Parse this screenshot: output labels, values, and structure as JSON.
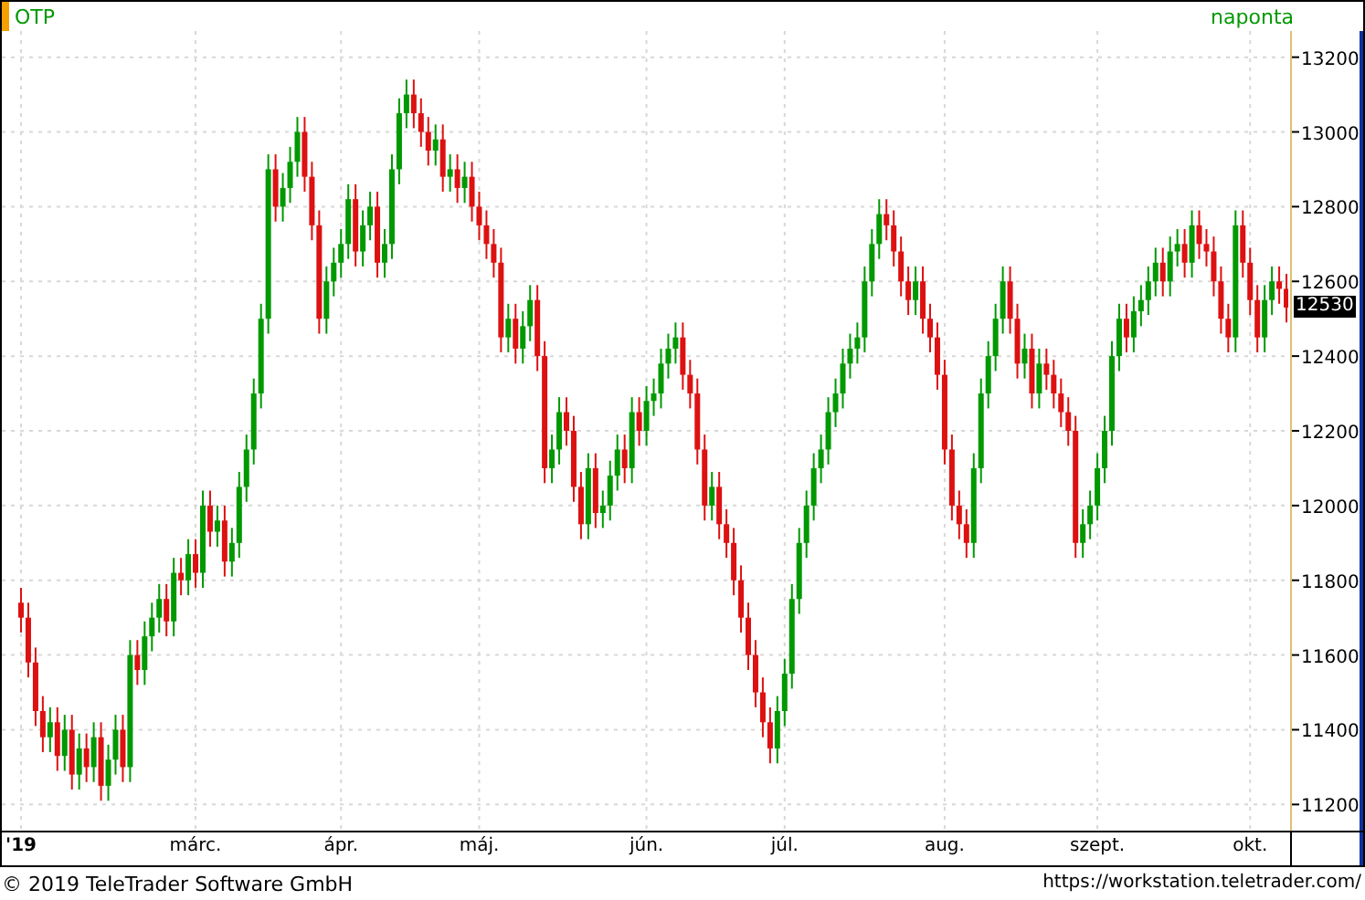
{
  "header": {
    "symbol": "OTP",
    "interval": "naponta"
  },
  "chart": {
    "price_marker": "12530",
    "chart_data": {
      "type": "candlestick",
      "grid": true,
      "ylim": [
        11130,
        13270
      ],
      "categories": [
        "'19",
        null,
        null,
        null,
        null,
        null,
        null,
        null,
        null,
        null,
        null,
        null,
        null,
        null,
        null,
        null,
        null,
        null,
        null,
        null,
        null,
        null,
        null,
        null,
        "márc.",
        null,
        null,
        null,
        null,
        null,
        null,
        null,
        null,
        null,
        null,
        null,
        null,
        null,
        null,
        null,
        null,
        null,
        null,
        null,
        "ápr.",
        null,
        null,
        null,
        null,
        null,
        null,
        null,
        null,
        null,
        null,
        null,
        null,
        null,
        null,
        null,
        null,
        null,
        null,
        "máj.",
        null,
        null,
        null,
        null,
        null,
        null,
        null,
        null,
        null,
        null,
        null,
        null,
        null,
        null,
        null,
        null,
        null,
        null,
        null,
        null,
        null,
        null,
        "jún.",
        null,
        null,
        null,
        null,
        null,
        null,
        null,
        null,
        null,
        null,
        null,
        null,
        null,
        null,
        null,
        null,
        null,
        null,
        "júl.",
        null,
        null,
        null,
        null,
        null,
        null,
        null,
        null,
        null,
        null,
        null,
        null,
        null,
        null,
        null,
        null,
        null,
        null,
        null,
        null,
        null,
        "aug.",
        null,
        null,
        null,
        null,
        null,
        null,
        null,
        null,
        null,
        null,
        null,
        null,
        null,
        null,
        null,
        null,
        null,
        null,
        null,
        null,
        "szept.",
        null,
        null,
        null,
        null,
        null,
        null,
        null,
        null,
        null,
        null,
        null,
        null,
        null,
        null,
        null,
        null,
        null,
        null,
        null,
        null,
        "okt.",
        null,
        null,
        null,
        null,
        null
      ],
      "yticks": [
        {
          "value": 11200,
          "label": "11200"
        },
        {
          "value": 11400,
          "label": "11400"
        },
        {
          "value": 11600,
          "label": "11600"
        },
        {
          "value": 11800,
          "label": "11800"
        },
        {
          "value": 12000,
          "label": "12000"
        },
        {
          "value": 12200,
          "label": "12200"
        },
        {
          "value": 12400,
          "label": "12400"
        },
        {
          "value": 12600,
          "label": "12600"
        },
        {
          "value": 12800,
          "label": "12800"
        },
        {
          "value": 13000,
          "label": "13000"
        },
        {
          "value": 13200,
          "label": "13200"
        }
      ],
      "ohlc": [
        [
          11740,
          11780,
          11660,
          11700
        ],
        [
          11700,
          11740,
          11540,
          11580
        ],
        [
          11580,
          11620,
          11410,
          11450
        ],
        [
          11450,
          11490,
          11340,
          11380
        ],
        [
          11380,
          11460,
          11340,
          11420
        ],
        [
          11420,
          11460,
          11290,
          11330
        ],
        [
          11330,
          11440,
          11290,
          11400
        ],
        [
          11400,
          11440,
          11240,
          11280
        ],
        [
          11280,
          11390,
          11240,
          11350
        ],
        [
          11350,
          11390,
          11260,
          11300
        ],
        [
          11300,
          11420,
          11260,
          11380
        ],
        [
          11380,
          11420,
          11210,
          11250
        ],
        [
          11250,
          11360,
          11210,
          11320
        ],
        [
          11320,
          11440,
          11280,
          11400
        ],
        [
          11400,
          11440,
          11260,
          11300
        ],
        [
          11300,
          11640,
          11260,
          11600
        ],
        [
          11600,
          11640,
          11520,
          11560
        ],
        [
          11560,
          11690,
          11520,
          11650
        ],
        [
          11650,
          11740,
          11610,
          11700
        ],
        [
          11700,
          11790,
          11660,
          11750
        ],
        [
          11750,
          11790,
          11650,
          11690
        ],
        [
          11690,
          11860,
          11650,
          11820
        ],
        [
          11820,
          11860,
          11760,
          11800
        ],
        [
          11800,
          11910,
          11760,
          11870
        ],
        [
          11870,
          11910,
          11780,
          11820
        ],
        [
          11820,
          12040,
          11780,
          12000
        ],
        [
          12000,
          12040,
          11890,
          11930
        ],
        [
          11930,
          12000,
          11890,
          11960
        ],
        [
          11960,
          12000,
          11810,
          11850
        ],
        [
          11850,
          11940,
          11810,
          11900
        ],
        [
          11900,
          12090,
          11860,
          12050
        ],
        [
          12050,
          12190,
          12010,
          12150
        ],
        [
          12150,
          12340,
          12110,
          12300
        ],
        [
          12300,
          12540,
          12260,
          12500
        ],
        [
          12500,
          12940,
          12460,
          12900
        ],
        [
          12900,
          12940,
          12760,
          12800
        ],
        [
          12800,
          12890,
          12760,
          12850
        ],
        [
          12850,
          12960,
          12810,
          12920
        ],
        [
          12920,
          13040,
          12880,
          13000
        ],
        [
          13000,
          13040,
          12840,
          12880
        ],
        [
          12880,
          12920,
          12710,
          12750
        ],
        [
          12750,
          12790,
          12460,
          12500
        ],
        [
          12500,
          12640,
          12460,
          12600
        ],
        [
          12600,
          12690,
          12560,
          12650
        ],
        [
          12650,
          12740,
          12610,
          12700
        ],
        [
          12700,
          12860,
          12660,
          12820
        ],
        [
          12820,
          12860,
          12640,
          12680
        ],
        [
          12680,
          12790,
          12640,
          12750
        ],
        [
          12750,
          12840,
          12710,
          12800
        ],
        [
          12800,
          12840,
          12610,
          12650
        ],
        [
          12650,
          12740,
          12610,
          12700
        ],
        [
          12700,
          12940,
          12660,
          12900
        ],
        [
          12900,
          13090,
          12860,
          13050
        ],
        [
          13050,
          13140,
          13010,
          13100
        ],
        [
          13100,
          13140,
          13010,
          13050
        ],
        [
          13050,
          13090,
          12960,
          13000
        ],
        [
          13000,
          13040,
          12910,
          12950
        ],
        [
          12950,
          13020,
          12910,
          12980
        ],
        [
          12980,
          13020,
          12840,
          12880
        ],
        [
          12880,
          12940,
          12840,
          12900
        ],
        [
          12900,
          12940,
          12810,
          12850
        ],
        [
          12850,
          12920,
          12810,
          12880
        ],
        [
          12880,
          12920,
          12760,
          12800
        ],
        [
          12800,
          12840,
          12710,
          12750
        ],
        [
          12750,
          12790,
          12660,
          12700
        ],
        [
          12700,
          12740,
          12610,
          12650
        ],
        [
          12650,
          12690,
          12410,
          12450
        ],
        [
          12450,
          12540,
          12410,
          12500
        ],
        [
          12500,
          12540,
          12380,
          12420
        ],
        [
          12420,
          12520,
          12380,
          12480
        ],
        [
          12480,
          12590,
          12440,
          12550
        ],
        [
          12550,
          12590,
          12360,
          12400
        ],
        [
          12400,
          12440,
          12060,
          12100
        ],
        [
          12100,
          12190,
          12060,
          12150
        ],
        [
          12150,
          12290,
          12110,
          12250
        ],
        [
          12250,
          12290,
          12160,
          12200
        ],
        [
          12200,
          12240,
          12010,
          12050
        ],
        [
          12050,
          12090,
          11910,
          11950
        ],
        [
          11950,
          12140,
          11910,
          12100
        ],
        [
          12100,
          12140,
          11940,
          11980
        ],
        [
          11980,
          12040,
          11940,
          12000
        ],
        [
          12000,
          12120,
          11960,
          12080
        ],
        [
          12080,
          12190,
          12040,
          12150
        ],
        [
          12150,
          12190,
          12060,
          12100
        ],
        [
          12100,
          12290,
          12060,
          12250
        ],
        [
          12250,
          12290,
          12160,
          12200
        ],
        [
          12200,
          12320,
          12160,
          12280
        ],
        [
          12280,
          12340,
          12240,
          12300
        ],
        [
          12300,
          12420,
          12260,
          12380
        ],
        [
          12380,
          12460,
          12340,
          12420
        ],
        [
          12420,
          12490,
          12380,
          12450
        ],
        [
          12450,
          12490,
          12310,
          12350
        ],
        [
          12350,
          12390,
          12260,
          12300
        ],
        [
          12300,
          12340,
          12110,
          12150
        ],
        [
          12150,
          12190,
          11960,
          12000
        ],
        [
          12000,
          12090,
          11960,
          12050
        ],
        [
          12050,
          12090,
          11910,
          11950
        ],
        [
          11950,
          11990,
          11860,
          11900
        ],
        [
          11900,
          11940,
          11760,
          11800
        ],
        [
          11800,
          11840,
          11660,
          11700
        ],
        [
          11700,
          11740,
          11560,
          11600
        ],
        [
          11600,
          11640,
          11460,
          11500
        ],
        [
          11500,
          11540,
          11380,
          11420
        ],
        [
          11420,
          11460,
          11310,
          11350
        ],
        [
          11350,
          11490,
          11310,
          11450
        ],
        [
          11450,
          11590,
          11410,
          11550
        ],
        [
          11550,
          11790,
          11510,
          11750
        ],
        [
          11750,
          11940,
          11710,
          11900
        ],
        [
          11900,
          12040,
          11860,
          12000
        ],
        [
          12000,
          12140,
          11960,
          12100
        ],
        [
          12100,
          12190,
          12060,
          12150
        ],
        [
          12150,
          12290,
          12110,
          12250
        ],
        [
          12250,
          12340,
          12210,
          12300
        ],
        [
          12300,
          12420,
          12260,
          12380
        ],
        [
          12380,
          12460,
          12340,
          12420
        ],
        [
          12420,
          12490,
          12380,
          12450
        ],
        [
          12450,
          12640,
          12410,
          12600
        ],
        [
          12600,
          12740,
          12560,
          12700
        ],
        [
          12700,
          12820,
          12660,
          12780
        ],
        [
          12780,
          12820,
          12710,
          12750
        ],
        [
          12750,
          12790,
          12640,
          12680
        ],
        [
          12680,
          12720,
          12560,
          12600
        ],
        [
          12600,
          12640,
          12510,
          12550
        ],
        [
          12550,
          12640,
          12510,
          12600
        ],
        [
          12600,
          12640,
          12460,
          12500
        ],
        [
          12500,
          12540,
          12410,
          12450
        ],
        [
          12450,
          12490,
          12310,
          12350
        ],
        [
          12350,
          12390,
          12110,
          12150
        ],
        [
          12150,
          12190,
          11960,
          12000
        ],
        [
          12000,
          12040,
          11910,
          11950
        ],
        [
          11950,
          11990,
          11860,
          11900
        ],
        [
          11900,
          12140,
          11860,
          12100
        ],
        [
          12100,
          12340,
          12060,
          12300
        ],
        [
          12300,
          12440,
          12260,
          12400
        ],
        [
          12400,
          12540,
          12360,
          12500
        ],
        [
          12500,
          12640,
          12460,
          12600
        ],
        [
          12600,
          12640,
          12460,
          12500
        ],
        [
          12500,
          12540,
          12340,
          12380
        ],
        [
          12380,
          12460,
          12340,
          12420
        ],
        [
          12420,
          12460,
          12260,
          12300
        ],
        [
          12300,
          12420,
          12260,
          12380
        ],
        [
          12380,
          12420,
          12310,
          12350
        ],
        [
          12350,
          12390,
          12260,
          12300
        ],
        [
          12300,
          12340,
          12210,
          12250
        ],
        [
          12250,
          12290,
          12160,
          12200
        ],
        [
          12200,
          12240,
          11860,
          11900
        ],
        [
          11900,
          11990,
          11860,
          11950
        ],
        [
          11950,
          12040,
          11910,
          12000
        ],
        [
          12000,
          12140,
          11960,
          12100
        ],
        [
          12100,
          12240,
          12060,
          12200
        ],
        [
          12200,
          12440,
          12160,
          12400
        ],
        [
          12400,
          12540,
          12360,
          12500
        ],
        [
          12500,
          12540,
          12410,
          12450
        ],
        [
          12450,
          12560,
          12410,
          12520
        ],
        [
          12520,
          12590,
          12480,
          12550
        ],
        [
          12550,
          12640,
          12510,
          12600
        ],
        [
          12600,
          12690,
          12560,
          12650
        ],
        [
          12650,
          12690,
          12560,
          12600
        ],
        [
          12600,
          12720,
          12560,
          12680
        ],
        [
          12680,
          12740,
          12640,
          12700
        ],
        [
          12700,
          12740,
          12610,
          12650
        ],
        [
          12650,
          12790,
          12610,
          12750
        ],
        [
          12750,
          12790,
          12660,
          12700
        ],
        [
          12700,
          12740,
          12640,
          12680
        ],
        [
          12680,
          12720,
          12560,
          12600
        ],
        [
          12600,
          12640,
          12460,
          12500
        ],
        [
          12500,
          12540,
          12410,
          12450
        ],
        [
          12450,
          12790,
          12410,
          12750
        ],
        [
          12750,
          12790,
          12610,
          12650
        ],
        [
          12650,
          12690,
          12510,
          12550
        ],
        [
          12550,
          12590,
          12410,
          12450
        ],
        [
          12450,
          12590,
          12410,
          12550
        ],
        [
          12550,
          12640,
          12510,
          12600
        ],
        [
          12600,
          12640,
          12540,
          12580
        ],
        [
          12580,
          12620,
          12490,
          12530
        ]
      ]
    }
  },
  "footer": {
    "copyright": "© 2019 TeleTrader Software GmbH",
    "url": "https://workstation.teletrader.com/"
  }
}
